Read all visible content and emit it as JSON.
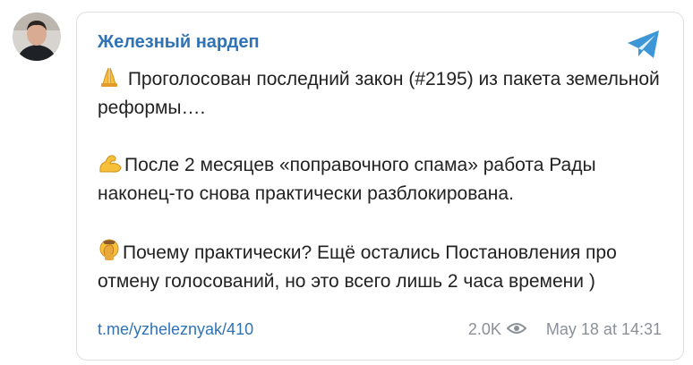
{
  "channel": {
    "name": "Железный нардеп"
  },
  "message": {
    "paragraphs": [
      {
        "emoji": "folded-hands-icon",
        "text": " Проголосован последний закон (#2195) из пакета земельной реформы…."
      },
      {
        "emoji": "flexed-biceps-icon",
        "text": "После 2 месяцев «поправочного спама» работа Рады наконец-то снова практически разблокирована."
      },
      {
        "emoji": "facepalm-icon",
        "text": "Почему практически? Ещё остались Постановления про отмену голосований, но это всего лишь 2 часа времени )"
      }
    ]
  },
  "footer": {
    "link": "t.me/yzheleznyak/410",
    "views": "2.0K",
    "date": "May 18 at 14:31"
  },
  "colors": {
    "accent": "#2f73b6",
    "telegram_logo": "#3d97d6",
    "meta_text": "#8b9197",
    "border": "#dcdfe3"
  }
}
